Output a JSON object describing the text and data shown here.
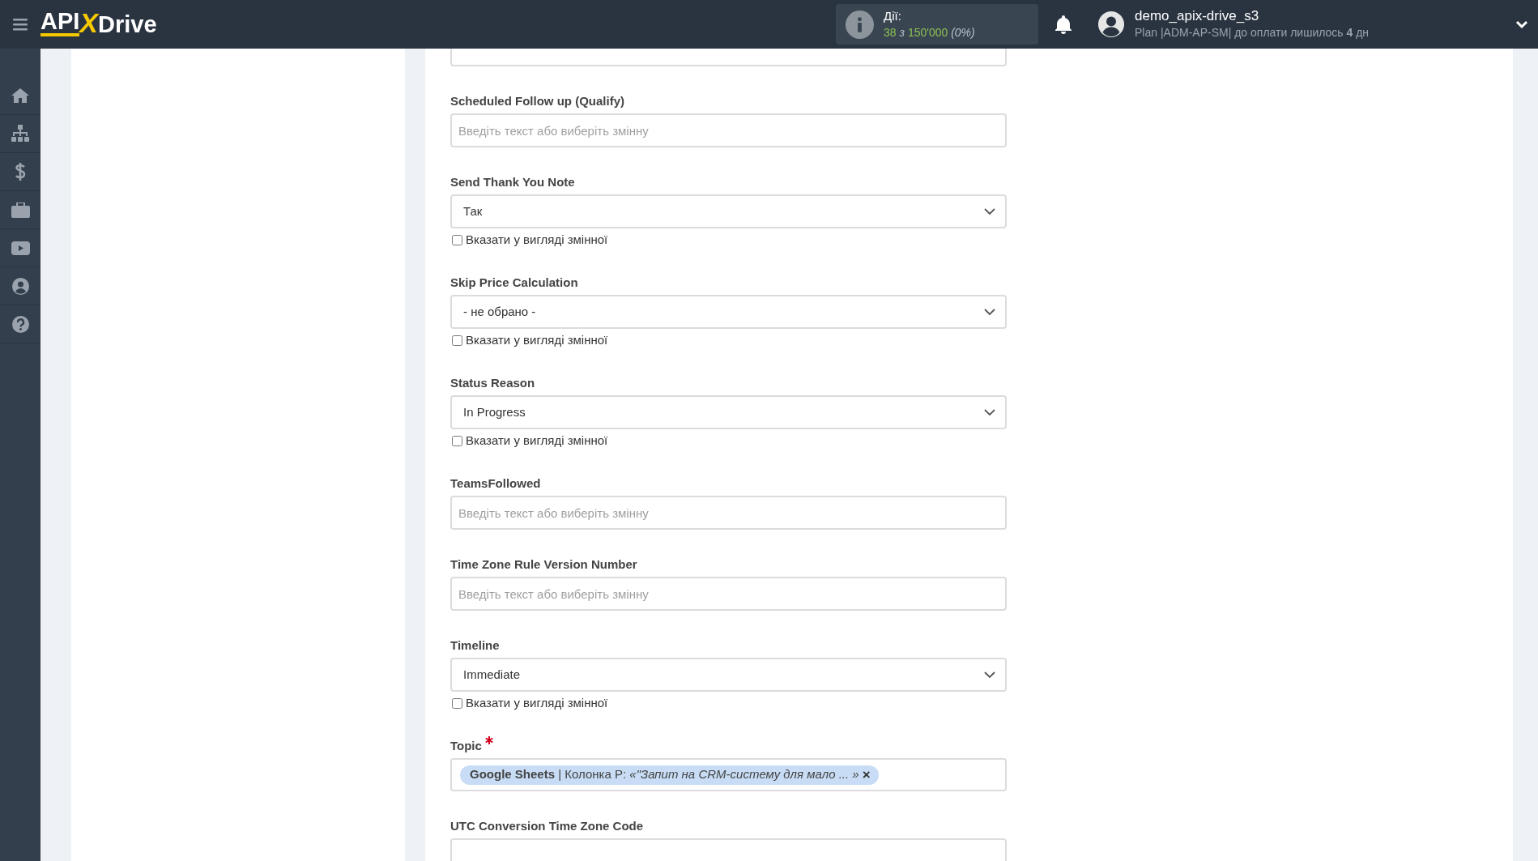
{
  "header": {
    "logo": {
      "left": "API",
      "mark": "X",
      "right": "Drive"
    },
    "actions": {
      "label": "Дії:",
      "used": "38",
      "of": "з",
      "total": "150'000",
      "percent": "(0%)"
    },
    "user": {
      "name": "demo_apix-drive_s3",
      "plan": "Plan |ADM-AP-SM| до оплати лишилось **4** дн"
    }
  },
  "fields": [
    {
      "kind": "text"
    },
    {
      "kind": "text",
      "label": "Scheduled Follow up (Qualify)",
      "placeholder": "Введіть текст або виберіть змінну"
    },
    {
      "kind": "select",
      "label": "Send Thank You Note",
      "value": "Так",
      "checkbox": {
        "label": "Вказати у вигляді змінної",
        "checked": false
      }
    },
    {
      "kind": "select",
      "label": "Skip Price Calculation",
      "value": "- не обрано -",
      "checkbox": {
        "label": "Вказати у вигляді змінної",
        "checked": false
      }
    },
    {
      "kind": "select",
      "label": "Status Reason",
      "value": "In Progress",
      "checkbox": {
        "label": "Вказати у вигляді змінної",
        "checked": false
      }
    },
    {
      "kind": "text",
      "label": "TeamsFollowed",
      "placeholder": "Введіть текст або виберіть змінну"
    },
    {
      "kind": "text",
      "label": "Time Zone Rule Version Number",
      "placeholder": "Введіть текст або виберіть змінну"
    },
    {
      "kind": "select",
      "label": "Timeline",
      "value": "Immediate",
      "checkbox": {
        "label": "Вказати у вигляді змінної",
        "checked": false
      }
    },
    {
      "kind": "tags",
      "label": "Topic",
      "required": true,
      "tags": [
        {
          "text": "**Google Sheets** | Колонка P: *«\"Запит на CRM-систему для мало ... »*",
          "remove": "×"
        }
      ]
    },
    {
      "kind": "text",
      "label": "UTC Conversion Time Zone Code"
    }
  ]
}
